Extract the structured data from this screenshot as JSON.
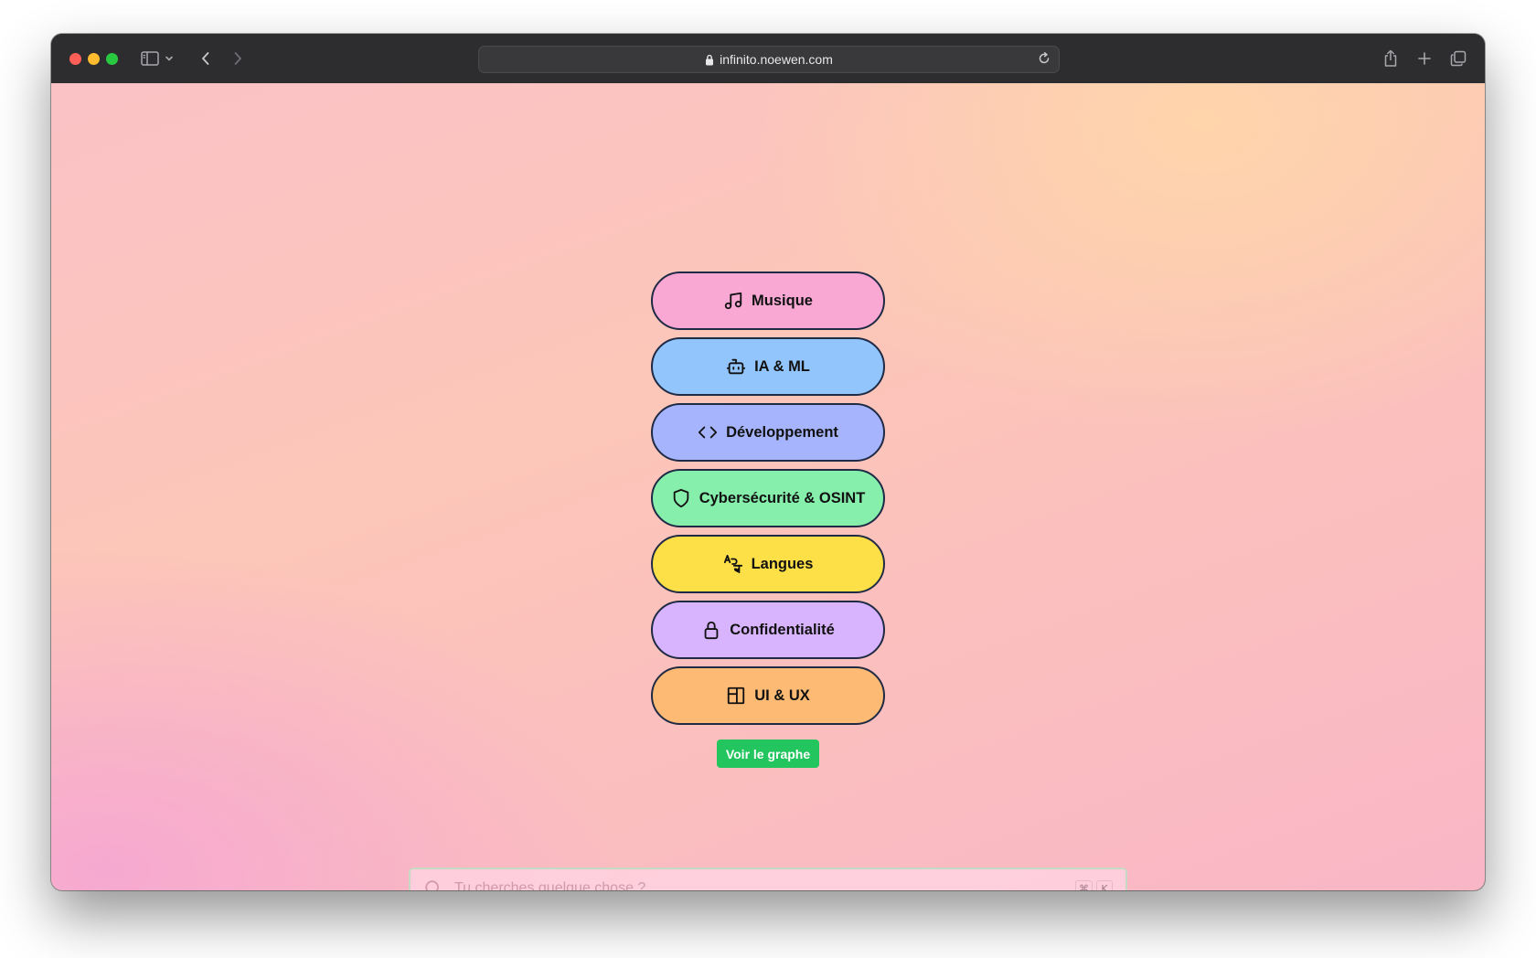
{
  "browser": {
    "url": "infinito.noewen.com"
  },
  "categories": [
    {
      "label": "Musique",
      "icon": "music-note-icon",
      "color": "#f9a8d4"
    },
    {
      "label": "IA & ML",
      "icon": "robot-icon",
      "color": "#93c5fd"
    },
    {
      "label": "Développement",
      "icon": "code-brackets-icon",
      "color": "#a5b4fc"
    },
    {
      "label": "Cybersécurité & OSINT",
      "icon": "shield-icon",
      "color": "#86efac"
    },
    {
      "label": "Langues",
      "icon": "translate-icon",
      "color": "#fde047"
    },
    {
      "label": "Confidentialité",
      "icon": "lock-icon",
      "color": "#d8b4fe"
    },
    {
      "label": "UI & UX",
      "icon": "layout-icon",
      "color": "#fdba74"
    }
  ],
  "graph_button": {
    "label": "Voir le graphe",
    "color": "#22c55e"
  },
  "search": {
    "placeholder": "Tu cherches quelque chose ?",
    "shortcut_modifier": "⌘",
    "shortcut_key": "K"
  }
}
